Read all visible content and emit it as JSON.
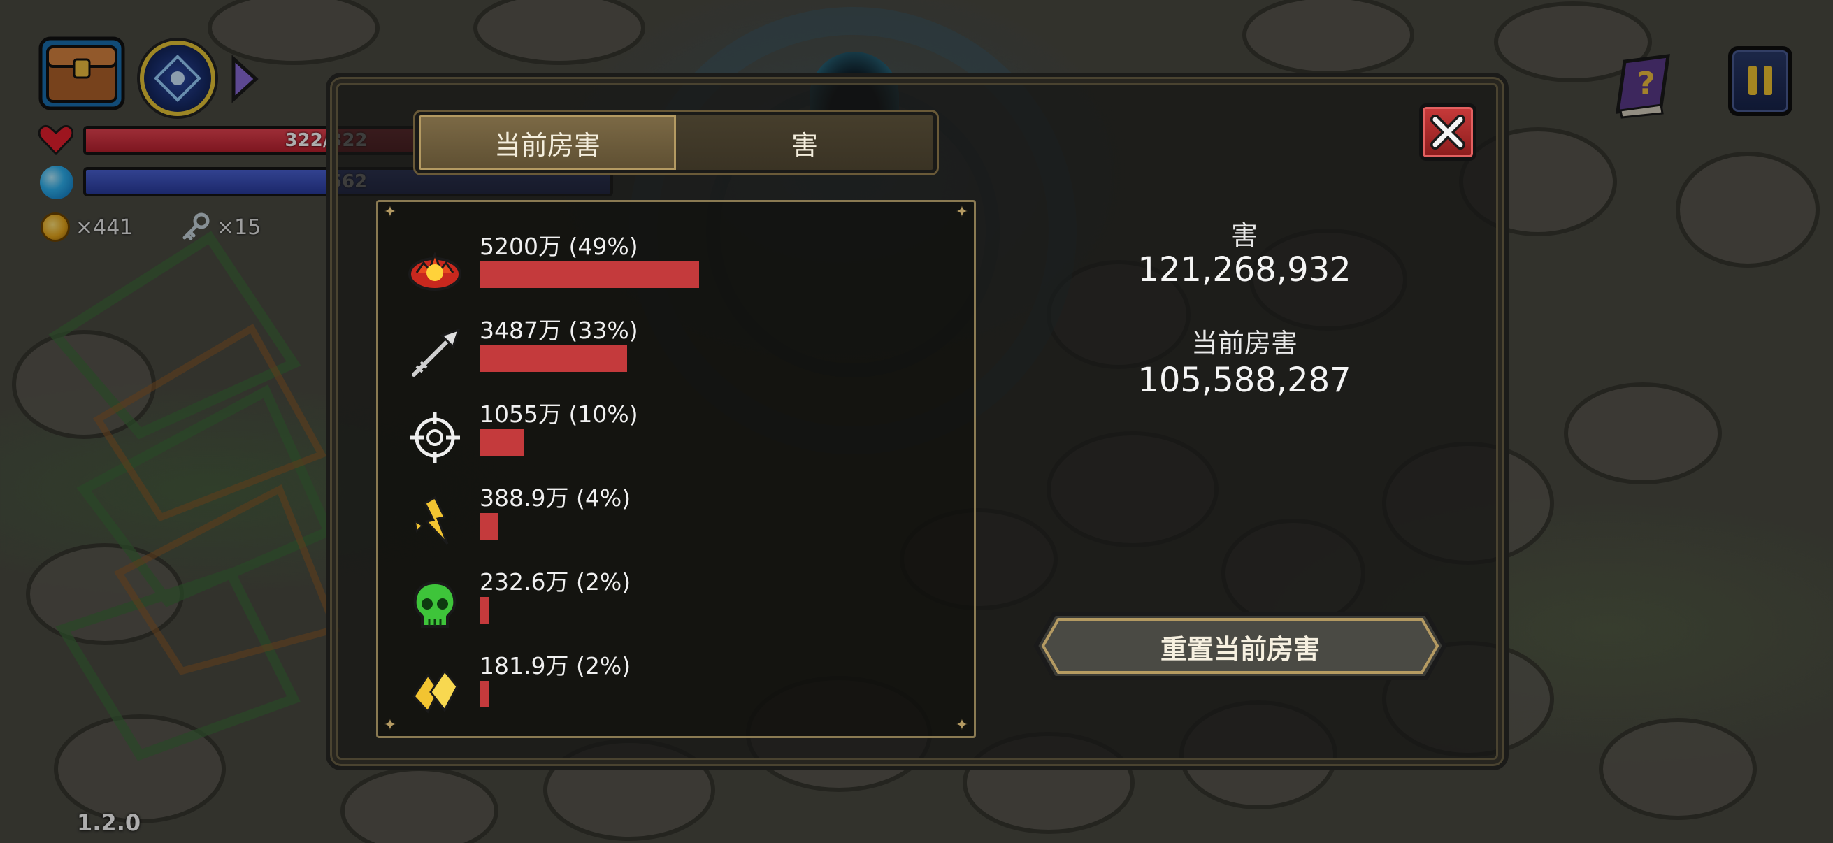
{
  "hud": {
    "hp": {
      "text": "322/322",
      "fraction": 1.0
    },
    "mp": {
      "text": "562",
      "fraction": 1.0
    },
    "gold": "×441",
    "keys": "×15",
    "version": "1.2.0"
  },
  "panel": {
    "tabs": [
      {
        "label": "当前房害",
        "active": true
      },
      {
        "label": "害",
        "active": false
      }
    ],
    "damage_rows": [
      {
        "icon": "fire-explosion-icon",
        "label": "5200万 (49%)",
        "fraction": 0.49
      },
      {
        "icon": "arrow-spear-icon",
        "label": "3487万 (33%)",
        "fraction": 0.33
      },
      {
        "icon": "target-crosshair-icon",
        "label": "1055万 (10%)",
        "fraction": 0.1
      },
      {
        "icon": "lightning-shard-icon",
        "label": "388.9万 (4%)",
        "fraction": 0.04
      },
      {
        "icon": "green-skull-icon",
        "label": "232.6万 (2%)",
        "fraction": 0.02
      },
      {
        "icon": "gold-crystal-icon",
        "label": "181.9万 (2%)",
        "fraction": 0.02
      }
    ],
    "total_label": "害",
    "total_value": "121,268,932",
    "room_label": "当前房害",
    "room_value": "105,588,287",
    "reset_label": "重置当前房害"
  },
  "colors": {
    "damage_bar": "#c43a3c",
    "hp_bar": "#d0303e",
    "mp_bar": "#3a4cb8",
    "accent_gold": "#b49a62"
  }
}
